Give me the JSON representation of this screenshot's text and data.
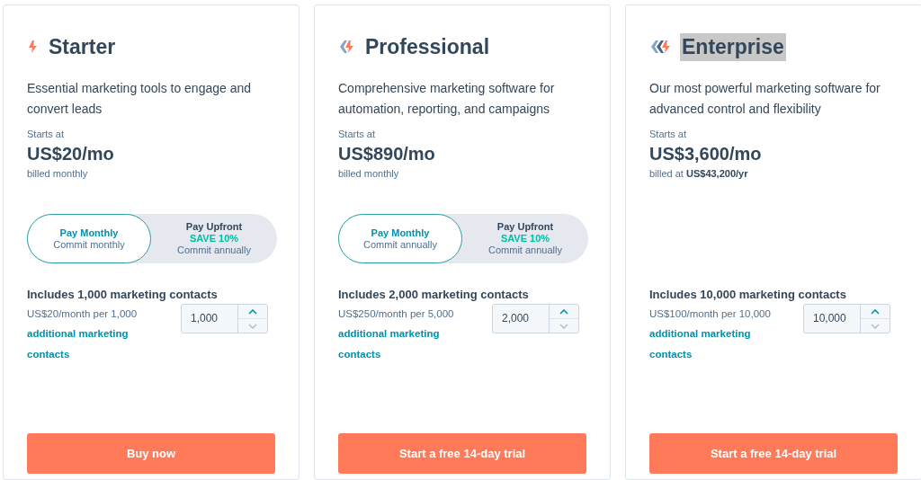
{
  "plans": [
    {
      "title": "Starter",
      "title_highlighted": false,
      "description": "Essential marketing tools to engage and convert leads",
      "starts_label": "Starts at",
      "price": "US$20/mo",
      "billing": "billed monthly",
      "toggle": [
        {
          "label": "Pay Monthly",
          "note": "Commit monthly",
          "selected": true
        },
        {
          "label": "Pay Upfront",
          "badge": "SAVE 10%",
          "note": "Commit annually",
          "selected": false
        }
      ],
      "contacts_heading": "Includes 1,000 marketing contacts",
      "contacts_rate": "US$20/month per 1,000",
      "contacts_link": "additional marketing contacts",
      "stepper": {
        "value": "1,000",
        "down_disabled": true
      },
      "button": "Buy now"
    },
    {
      "title": "Professional",
      "title_highlighted": false,
      "description": "Comprehensive marketing software for automation, reporting, and campaigns",
      "starts_label": "Starts at",
      "price": "US$890/mo",
      "billing": "billed monthly",
      "toggle": [
        {
          "label": "Pay Monthly",
          "note": "Commit annually",
          "selected": true
        },
        {
          "label": "Pay Upfront",
          "badge": "SAVE 10%",
          "note": "Commit annually",
          "selected": false
        }
      ],
      "contacts_heading": "Includes 2,000 marketing contacts",
      "contacts_rate": "US$250/month per 5,000",
      "contacts_link": "additional marketing contacts",
      "stepper": {
        "value": "2,000",
        "down_disabled": true
      },
      "button": "Start a free 14-day trial"
    },
    {
      "title": "Enterprise",
      "title_highlighted": true,
      "description": "Our most powerful marketing software for advanced control and flexibility",
      "starts_label": "Starts at",
      "price": "US$3,600/mo",
      "billing": "billed at **US$43,200/yr**",
      "contacts_heading": "Includes 10,000 marketing contacts",
      "contacts_rate": "US$100/month per 10,000",
      "contacts_link": "additional marketing contacts",
      "stepper": {
        "value": "10,000",
        "down_disabled": true
      },
      "button": "Start a free 14-day trial"
    }
  ]
}
